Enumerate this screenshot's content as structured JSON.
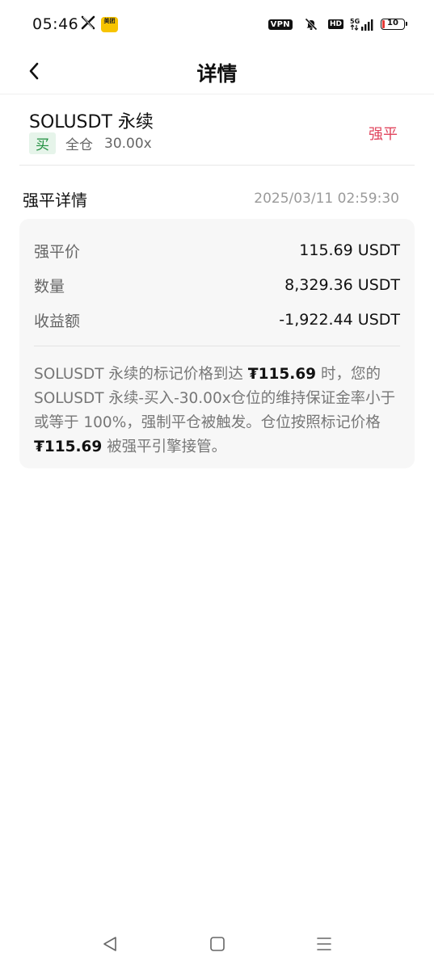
{
  "status_bar": {
    "time": "05:46",
    "meituan_label": "美团",
    "vpn_label": "VPN",
    "hd_label": "HD",
    "network_label": "5G",
    "battery_level": "10",
    "icons": [
      "x-logo-icon",
      "meituan-app-icon",
      "vpn-icon",
      "mute-icon",
      "hd-icon",
      "signal-icon",
      "battery-icon"
    ],
    "battery_color": "#e53935"
  },
  "nav": {
    "title": "详情",
    "back_icon": "chevron-left-icon"
  },
  "contract": {
    "name": "SOLUSDT 永续",
    "side": "买",
    "margin_mode": "全仓",
    "leverage": "30.00x",
    "status_tag": "强平",
    "side_color": "#1e8e3e",
    "tag_color": "#e0445c"
  },
  "liquidation": {
    "section_title": "强平详情",
    "timestamp": "2025/03/11 02:59:30",
    "rows": [
      {
        "label": "强平价",
        "value": "115.69 USDT"
      },
      {
        "label": "数量",
        "value": "8,329.36 USDT"
      },
      {
        "label": "收益额",
        "value": "-1,922.44 USDT"
      }
    ],
    "description": {
      "p1": "SOLUSDT 永续的标记价格到达 ",
      "price1": "₮115.69",
      "p2": " 时，您的SOLUSDT 永续-买入-30.00x仓位的维持保证金率小于或等于 100%，强制平仓被触发。仓位按照标记价格 ",
      "price2": "₮115.69",
      "p3": " 被强平引擎接管。"
    }
  },
  "bottom_nav": {
    "icons": [
      "back-triangle-icon",
      "home-square-icon",
      "recents-menu-icon"
    ]
  }
}
